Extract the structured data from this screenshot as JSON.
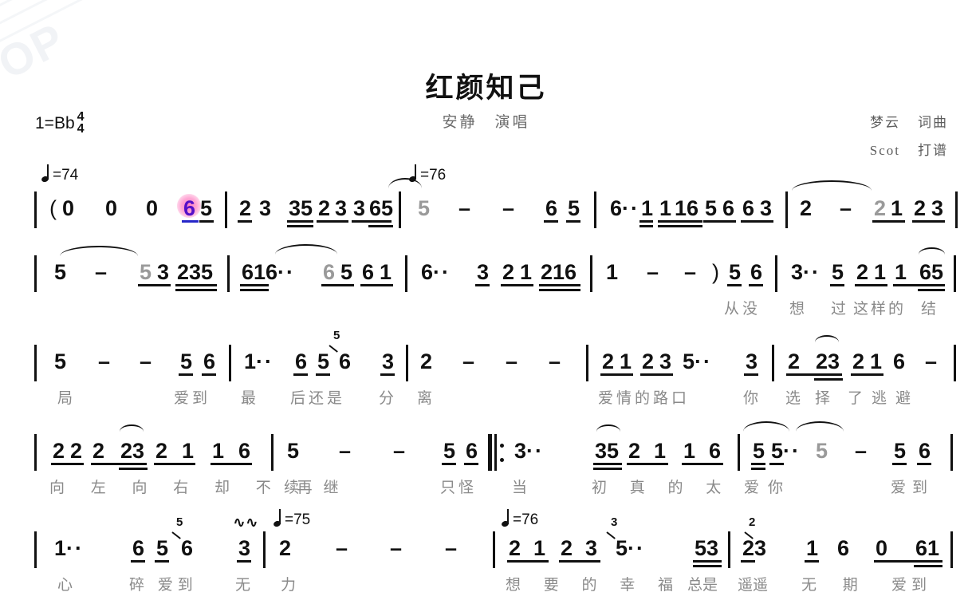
{
  "document": {
    "kind": "numbered-musical-notation-jianpu",
    "watermark_text": "OP"
  },
  "header": {
    "title": "红颜知己",
    "performer_line": "安静　演唱",
    "credits": [
      {
        "name": "梦云",
        "role": "词曲"
      },
      {
        "name": "Scot",
        "role": "打谱"
      }
    ],
    "key_label": "1=Bb",
    "time_signature": {
      "numerator": "4",
      "denominator": "4"
    }
  },
  "tempo_marks": [
    {
      "id": "t1",
      "value": "=74"
    },
    {
      "id": "t2",
      "value": "=76"
    },
    {
      "id": "t3",
      "value": "=75"
    },
    {
      "id": "t4",
      "value": "=76"
    }
  ],
  "symbols": {
    "open_paren": "(",
    "close_paren": ")",
    "dash": "–",
    "dot": "·",
    "mordent": "∿∿"
  },
  "staves": [
    {
      "id": "stave-1",
      "notes": [
        "(",
        "0",
        "0",
        "0",
        "6",
        "5",
        "2",
        "3",
        "35",
        "2",
        "3",
        "3",
        "65",
        "5",
        "–",
        "–",
        "6",
        "5",
        "6·",
        "1",
        "1",
        "16",
        "5",
        "6",
        "6",
        "3",
        "2",
        "–",
        "2",
        "1",
        "2",
        "3"
      ]
    },
    {
      "id": "stave-2",
      "notes": [
        "5",
        "–",
        "5",
        "3",
        "235",
        "616·",
        "6",
        "5",
        "6",
        "1",
        "6·",
        "3",
        "2",
        "1",
        "216",
        "1",
        "–",
        "–",
        ")",
        "5",
        "6",
        "3·",
        "5",
        "2",
        "1",
        "1",
        "65"
      ],
      "lyrics": [
        "从没",
        "想",
        "过",
        "这样的",
        "结"
      ]
    },
    {
      "id": "stave-3",
      "notes": [
        "5",
        "–",
        "–",
        "5",
        "6",
        "1·",
        "6",
        "5",
        "6",
        "3",
        "2",
        "–",
        "–",
        "–",
        "2",
        "1",
        "2",
        "3",
        "5·",
        "3",
        "2",
        "23",
        "2",
        "1",
        "6",
        "–"
      ],
      "lyrics": [
        "局",
        "爱到",
        "最",
        "后还是",
        "分",
        "离",
        "爱情的路口",
        "你",
        "选择",
        "了逃避"
      ],
      "grace": [
        "5"
      ]
    },
    {
      "id": "stave-4",
      "notes": [
        "2",
        "2",
        "2",
        "23",
        "2",
        "1",
        "1",
        "6",
        "5",
        "–",
        "–",
        "5",
        "6",
        "3·",
        "35",
        "2",
        "1",
        "1",
        "6",
        "5",
        "5·",
        "5",
        "–",
        "5",
        "6"
      ],
      "lyrics": [
        "向 左 向 右 却 不 再继",
        "续",
        "只怪",
        "当",
        "初 真 的 太 爱",
        "你",
        "爱到"
      ]
    },
    {
      "id": "stave-5",
      "notes": [
        "1·",
        "6",
        "5",
        "6",
        "3",
        "2",
        "–",
        "–",
        "–",
        "2",
        "1",
        "2",
        "3",
        "5·",
        "53",
        "23",
        "1",
        "6",
        "0",
        "61"
      ],
      "lyrics": [
        "心",
        "碎 爱到",
        "无",
        "力",
        "想 要 的 幸 福",
        "总是",
        "遥遥",
        "无 期",
        "爱到"
      ],
      "grace": [
        "5",
        "3",
        "2"
      ]
    }
  ],
  "cursor": {
    "on_note": "6",
    "stave": "stave-1",
    "halo_color": "#ff78be",
    "note_color": "#5510c8",
    "beam_color": "#2626c8"
  },
  "lyrics_color": "#8a8a8a",
  "ink_color": "#111111",
  "grey_note_color": "#9a9a9a"
}
